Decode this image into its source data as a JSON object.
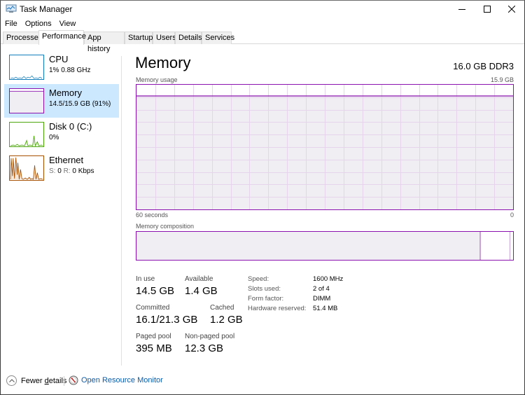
{
  "window": {
    "title": "Task Manager",
    "controls": [
      "minimize",
      "maximize",
      "close"
    ]
  },
  "menu": [
    "File",
    "Options",
    "View"
  ],
  "tabs": [
    {
      "label": "Processes",
      "active": false
    },
    {
      "label": "Performance",
      "active": true
    },
    {
      "label": "App history",
      "active": false
    },
    {
      "label": "Startup",
      "active": false
    },
    {
      "label": "Users",
      "active": false
    },
    {
      "label": "Details",
      "active": false
    },
    {
      "label": "Services",
      "active": false
    }
  ],
  "sidebar": {
    "items": [
      {
        "title": "CPU",
        "subtitle": "1% 0.88 GHz",
        "color": "#117dbb",
        "active": false
      },
      {
        "title": "Memory",
        "subtitle": "14.5/15.9 GB (91%)",
        "color": "#8b12ae",
        "active": true
      },
      {
        "title": "Disk 0 (C:)",
        "subtitle": "0%",
        "color": "#4da60c",
        "active": false
      },
      {
        "title": "Ethernet",
        "subtitle_s_label": "S:",
        "subtitle_s_value": "0",
        "subtitle_r_label": "R:",
        "subtitle_r_value": "0 Kbps",
        "color": "#a74f01",
        "active": false
      }
    ]
  },
  "main": {
    "title": "Memory",
    "spec": "16.0 GB DDR3",
    "usage_label": "Memory usage",
    "usage_max": "15.9 GB",
    "axis_left": "60 seconds",
    "axis_right": "0",
    "usage_fraction": 0.91,
    "composition_label": "Memory composition",
    "composition": {
      "in_use_fraction": 0.91,
      "modified_fraction": 0.005,
      "standby_fraction": 0.075,
      "free_fraction": 0.01
    },
    "stats": {
      "in_use_label": "In use",
      "in_use_value": "14.5 GB",
      "available_label": "Available",
      "available_value": "1.4 GB",
      "committed_label": "Committed",
      "committed_value": "16.1/21.3 GB",
      "cached_label": "Cached",
      "cached_value": "1.2 GB",
      "paged_label": "Paged pool",
      "paged_value": "395 MB",
      "nonpaged_label": "Non-paged pool",
      "nonpaged_value": "12.3 GB"
    },
    "specs": [
      {
        "label": "Speed:",
        "value": "1600 MHz"
      },
      {
        "label": "Slots used:",
        "value": "2 of 4"
      },
      {
        "label": "Form factor:",
        "value": "DIMM"
      },
      {
        "label": "Hardware reserved:",
        "value": "51.4 MB"
      }
    ]
  },
  "footer": {
    "fewer_details_prefix": "Fewer ",
    "fewer_details_accel": "d",
    "fewer_details_suffix": "etails",
    "resource_monitor": "Open Resource Monitor"
  },
  "colors": {
    "memory": "#8b12ae",
    "memory_fill": "#f1eef3",
    "cpu": "#117dbb",
    "disk": "#4da60c",
    "ethernet": "#a74f01",
    "selection": "#cce8ff",
    "link": "#0a5cad"
  }
}
